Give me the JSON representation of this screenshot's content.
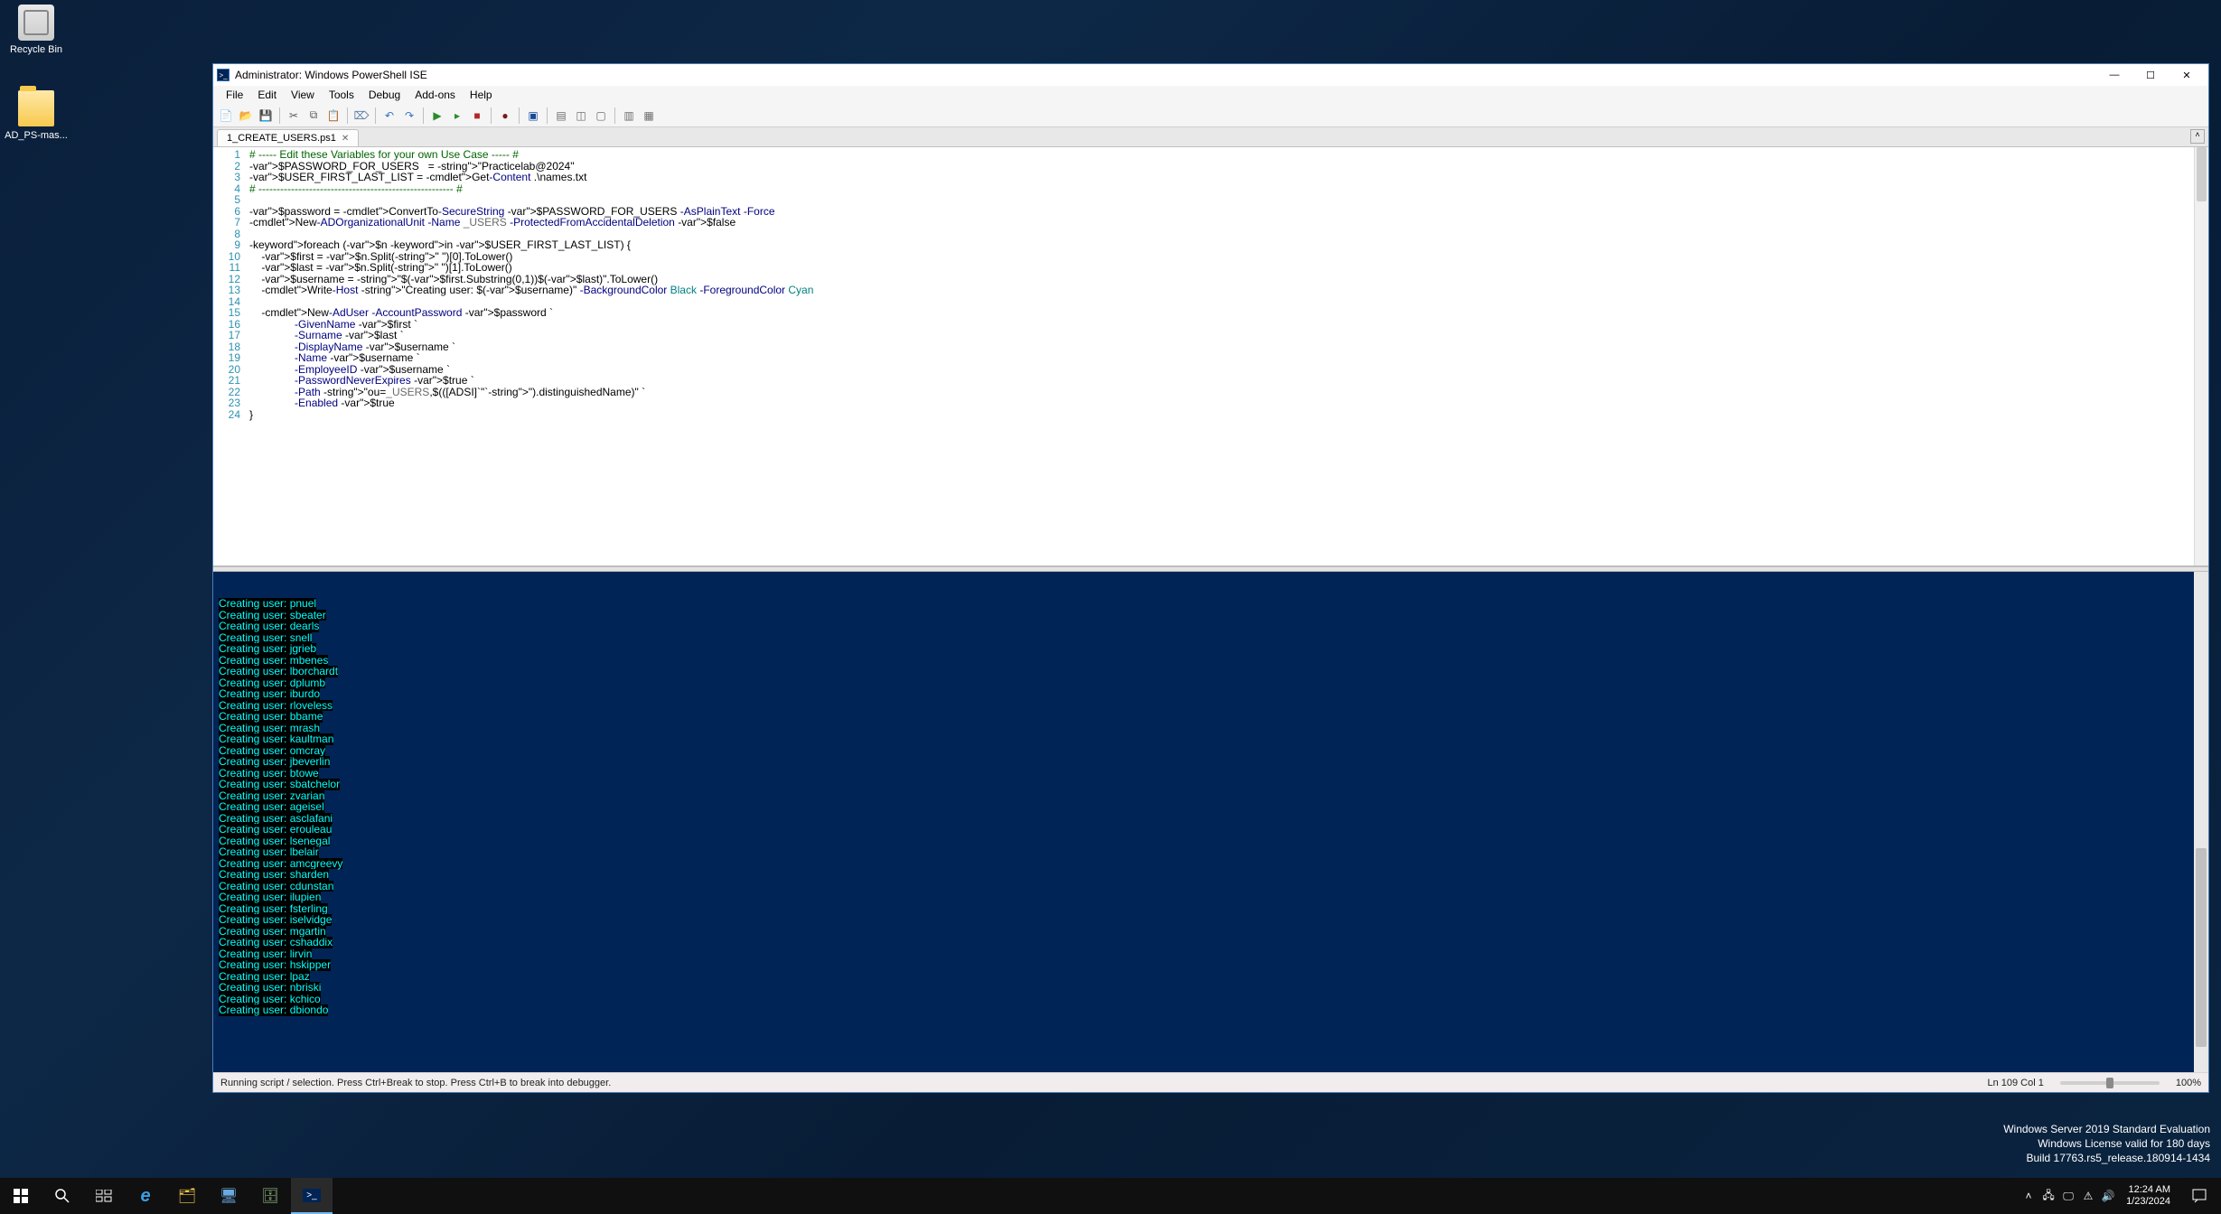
{
  "desktop": {
    "recycle_label": "Recycle Bin",
    "folder_label": "AD_PS-mas..."
  },
  "window": {
    "title": "Administrator: Windows PowerShell ISE"
  },
  "menu": {
    "file": "File",
    "edit": "Edit",
    "view": "View",
    "tools": "Tools",
    "debug": "Debug",
    "addons": "Add-ons",
    "help": "Help"
  },
  "tab": {
    "name": "1_CREATE_USERS.ps1"
  },
  "script": {
    "lines": [
      "# ----- Edit these Variables for your own Use Case ----- #",
      "$PASSWORD_FOR_USERS   = \"Practicelab@2024\"",
      "$USER_FIRST_LAST_LIST = Get-Content .\\names.txt",
      "# ------------------------------------------------------ #",
      "",
      "$password = ConvertTo-SecureString $PASSWORD_FOR_USERS -AsPlainText -Force",
      "New-ADOrganizationalUnit -Name _USERS -ProtectedFromAccidentalDeletion $false",
      "",
      "foreach ($n in $USER_FIRST_LAST_LIST) {",
      "    $first = $n.Split(\" \")[0].ToLower()",
      "    $last = $n.Split(\" \")[1].ToLower()",
      "    $username = \"$($first.Substring(0,1))$($last)\".ToLower()",
      "    Write-Host \"Creating user: $($username)\" -BackgroundColor Black -ForegroundColor Cyan",
      "",
      "    New-AdUser -AccountPassword $password `",
      "               -GivenName $first `",
      "               -Surname $last `",
      "               -DisplayName $username `",
      "               -Name $username `",
      "               -EmployeeID $username `",
      "               -PasswordNeverExpires $true `",
      "               -Path \"ou=_USERS,$(([ADSI]`\"`\").distinguishedName)\" `",
      "               -Enabled $true",
      "}"
    ]
  },
  "console": {
    "output_users": [
      "pnuel",
      "sbeater",
      "dearls",
      "snell",
      "jgrieb",
      "mbenes",
      "lborchardt",
      "dplumb",
      "iburdo",
      "rloveless",
      "bbame",
      "mrash",
      "kaultman",
      "omcray",
      "jbeverlin",
      "btowe",
      "sbatchelor",
      "zvarian",
      "ageisel",
      "asclafani",
      "erouleau",
      "lsenegal",
      "lbelair",
      "amcgreevy",
      "sharden",
      "cdunstan",
      "ilupien",
      "fsterling",
      "iselvidge",
      "mgartin",
      "cshaddix",
      "lirvin",
      "hskipper",
      "lpaz",
      "nbriski",
      "kchico",
      "dbiondo"
    ],
    "prefix": "Creating user: "
  },
  "status": {
    "left": "Running script / selection.  Press Ctrl+Break to stop.  Press Ctrl+B to break into debugger.",
    "pos": "Ln 109  Col 1",
    "zoom": "100%"
  },
  "watermark": {
    "l1": "Windows Server 2019 Standard Evaluation",
    "l2": "Windows License valid for 180 days",
    "l3": "Build 17763.rs5_release.180914-1434"
  },
  "taskbar": {
    "time": "12:24 AM",
    "date": "1/23/2024"
  }
}
